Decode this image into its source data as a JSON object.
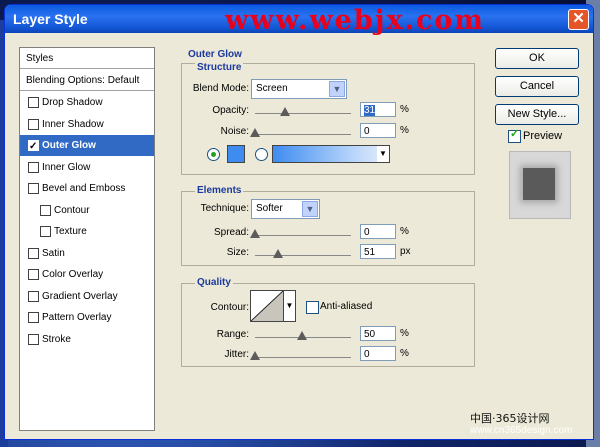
{
  "window": {
    "title": "Layer Style",
    "close_glyph": "✕"
  },
  "watermark_top": "www.webjx.com",
  "styles_panel": {
    "header": "Styles",
    "blending": "Blending Options: Default",
    "items": [
      {
        "label": "Drop Shadow",
        "checked": false
      },
      {
        "label": "Inner Shadow",
        "checked": false
      },
      {
        "label": "Outer Glow",
        "checked": true,
        "selected": true
      },
      {
        "label": "Inner Glow",
        "checked": false
      },
      {
        "label": "Bevel and Emboss",
        "checked": false
      },
      {
        "label": "Contour",
        "checked": false,
        "indent": true
      },
      {
        "label": "Texture",
        "checked": false,
        "indent": true
      },
      {
        "label": "Satin",
        "checked": false
      },
      {
        "label": "Color Overlay",
        "checked": false
      },
      {
        "label": "Gradient Overlay",
        "checked": false
      },
      {
        "label": "Pattern Overlay",
        "checked": false
      },
      {
        "label": "Stroke",
        "checked": false
      }
    ]
  },
  "outer_glow": {
    "heading": "Outer Glow",
    "structure": {
      "heading": "Structure",
      "blend_mode_label": "Blend Mode:",
      "blend_mode_value": "Screen",
      "opacity_label": "Opacity:",
      "opacity_value": "31",
      "opacity_unit": "%",
      "noise_label": "Noise:",
      "noise_value": "0",
      "noise_unit": "%",
      "color_swatch": "#3f8cf0"
    },
    "elements": {
      "heading": "Elements",
      "technique_label": "Technique:",
      "technique_value": "Softer",
      "spread_label": "Spread:",
      "spread_value": "0",
      "spread_unit": "%",
      "size_label": "Size:",
      "size_value": "51",
      "size_unit": "px"
    },
    "quality": {
      "heading": "Quality",
      "contour_label": "Contour:",
      "anti_aliased_label": "Anti-aliased",
      "range_label": "Range:",
      "range_value": "50",
      "range_unit": "%",
      "jitter_label": "Jitter:",
      "jitter_value": "0",
      "jitter_unit": "%"
    }
  },
  "buttons": {
    "ok": "OK",
    "cancel": "Cancel",
    "new_style": "New Style...",
    "preview": "Preview"
  },
  "footer": {
    "site1": "中国·365设计网",
    "site2": "www.cn365design.com"
  }
}
